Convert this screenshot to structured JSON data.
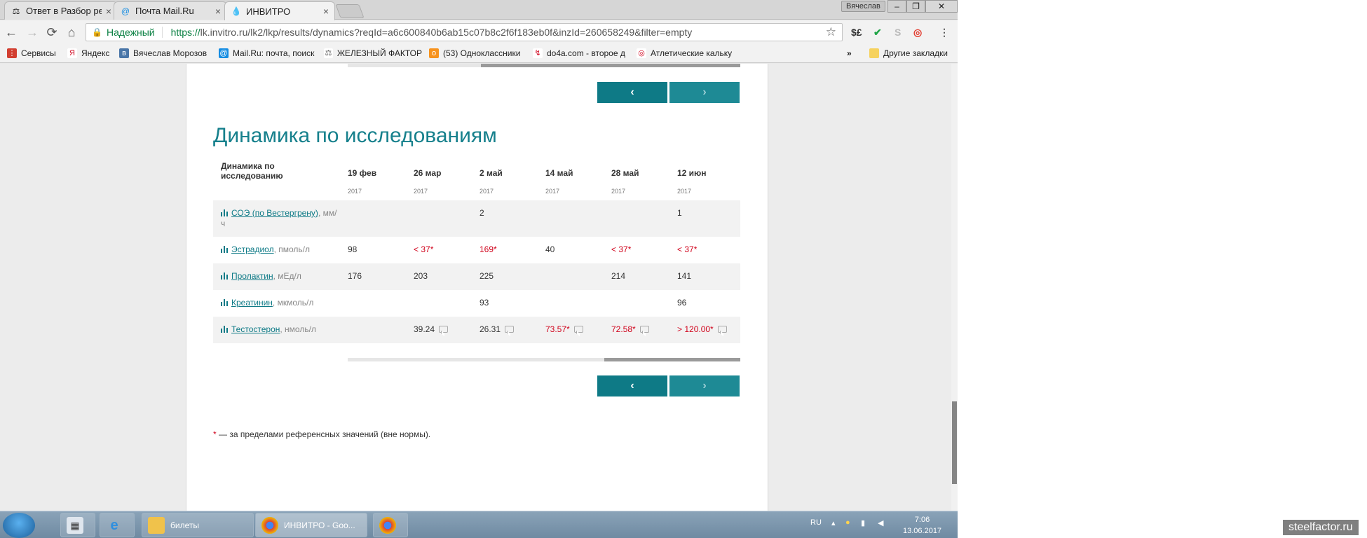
{
  "browser": {
    "tabs": [
      {
        "label": "Ответ в Разбор результ",
        "icon": "forum-icon"
      },
      {
        "label": "Почта Mail.Ru",
        "icon": "mail-icon"
      },
      {
        "label": "ИНВИТРО",
        "icon": "drop-icon"
      }
    ],
    "user_badge": "Вячеслав",
    "address": {
      "secure_label": "Надежный",
      "protocol": "https://",
      "url_rest": "lk.invitro.ru/lk2/lkp/results/dynamics?reqId=a6c600840b6ab15c07b8c2f6f183eb0f&inzId=260658249&filter=empty"
    },
    "bookmarks": [
      {
        "label": "Сервисы",
        "icon": "apps-icon",
        "color": "#d23f31"
      },
      {
        "label": "Яндекс",
        "icon": "yandex-icon",
        "color": "#ffffff"
      },
      {
        "label": "Вячеслав Морозов",
        "icon": "vk-icon",
        "color": "#4a76a8"
      },
      {
        "label": "Mail.Ru: почта, поиск",
        "icon": "mailru-icon",
        "color": "#168de2"
      },
      {
        "label": "ЖЕЛЕЗНЫЙ ФАКТОР",
        "icon": "forum-icon",
        "color": "#555555"
      },
      {
        "label": "(53) Одноклассники",
        "icon": "ok-icon",
        "color": "#f7931e"
      },
      {
        "label": "do4a.com - второе д",
        "icon": "do4a-icon",
        "color": "#d0021b"
      },
      {
        "label": "Атлетические кальку",
        "icon": "calc-icon",
        "color": "#d0021b"
      }
    ],
    "bookmarks_more": "»",
    "other_bookmarks": "Другие закладки"
  },
  "page": {
    "heading": "Динамика по исследованиям",
    "table_header_label": "Динамика по исследованию",
    "pager": {
      "prev": "‹",
      "next": "›"
    },
    "columns": [
      {
        "date": "19 фев",
        "year": "2017"
      },
      {
        "date": "26 мар",
        "year": "2017"
      },
      {
        "date": "2 май",
        "year": "2017"
      },
      {
        "date": "14 май",
        "year": "2017"
      },
      {
        "date": "28 май",
        "year": "2017"
      },
      {
        "date": "12 июн",
        "year": "2017"
      }
    ],
    "rows": [
      {
        "name": "СОЭ (по Вестергрену)",
        "unit": ", мм/ч",
        "values": [
          "",
          "",
          "2",
          "",
          "",
          "1"
        ],
        "out_of_range": [
          false,
          false,
          false,
          false,
          false,
          false
        ],
        "comment": [
          false,
          false,
          false,
          false,
          false,
          false
        ]
      },
      {
        "name": "Эстрадиол",
        "unit": ", пмоль/л",
        "values": [
          "98",
          "< 37*",
          "169*",
          "40",
          "< 37*",
          "< 37*"
        ],
        "out_of_range": [
          false,
          true,
          true,
          false,
          true,
          true
        ],
        "comment": [
          false,
          false,
          false,
          false,
          false,
          false
        ]
      },
      {
        "name": "Пролактин",
        "unit": ", мЕд/л",
        "values": [
          "176",
          "203",
          "225",
          "",
          "214",
          "141"
        ],
        "out_of_range": [
          false,
          false,
          false,
          false,
          false,
          false
        ],
        "comment": [
          false,
          false,
          false,
          false,
          false,
          false
        ]
      },
      {
        "name": "Креатинин",
        "unit": ", мкмоль/л",
        "values": [
          "",
          "",
          "93",
          "",
          "",
          "96"
        ],
        "out_of_range": [
          false,
          false,
          false,
          false,
          false,
          false
        ],
        "comment": [
          false,
          false,
          false,
          false,
          false,
          false
        ]
      },
      {
        "name": "Тестостерон",
        "unit": ", нмоль/л",
        "values": [
          "",
          "39.24",
          "26.31",
          "73.57*",
          "72.58*",
          "> 120.00*"
        ],
        "out_of_range": [
          false,
          false,
          false,
          true,
          true,
          true
        ],
        "comment": [
          false,
          true,
          true,
          true,
          true,
          true
        ]
      }
    ],
    "footnote_star": "*",
    "footnote_text": " — за пределами референсных значений (вне нормы).",
    "accent_color": "#16808c",
    "alert_color": "#d0021b"
  },
  "taskbar": {
    "items": [
      {
        "label": "",
        "icon": "calculator-icon"
      },
      {
        "label": "",
        "icon": "ie-icon"
      },
      {
        "label": "билеты",
        "icon": "folder-icon"
      },
      {
        "label": "ИНВИТРО - Goo...",
        "icon": "chrome-icon"
      },
      {
        "label": "",
        "icon": "chrome-icon"
      }
    ],
    "lang": "RU",
    "time": "7:06",
    "date": "13.06.2017"
  },
  "watermark": "steelfactor.ru"
}
